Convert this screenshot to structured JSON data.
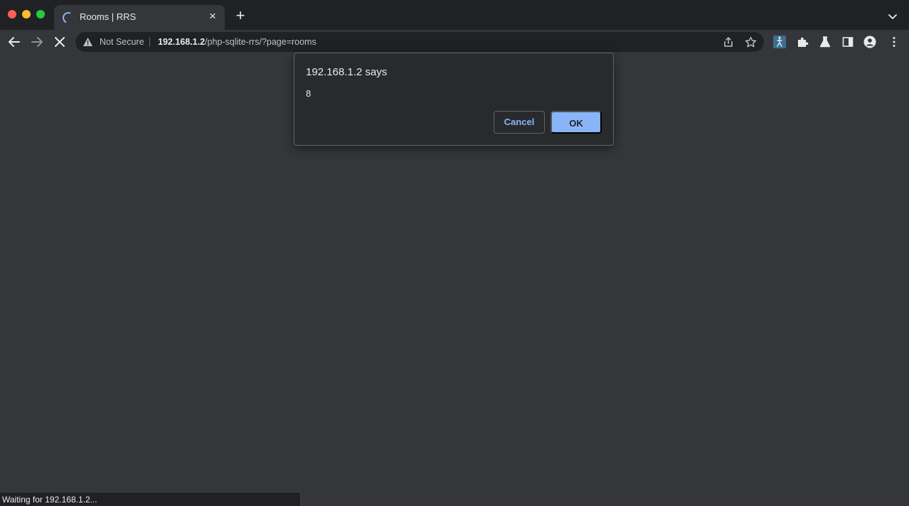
{
  "window": {
    "controls": [
      "close",
      "minimize",
      "maximize"
    ]
  },
  "tab": {
    "title": "Rooms | RRS",
    "loading": true
  },
  "toolbar": {
    "back_icon": "arrow-left-icon",
    "forward_icon": "arrow-right-icon",
    "stop_icon": "close-icon",
    "security_label": "Not Secure",
    "url_host": "192.168.1.2",
    "url_path": "/php-sqlite-rrs/?page=rooms",
    "extensions": [
      "custom-extension-icon",
      "puzzle-icon",
      "flask-icon",
      "side-panel-icon",
      "profile-icon",
      "kebab-menu-icon"
    ]
  },
  "dialog": {
    "title": "192.168.1.2 says",
    "message": "8",
    "cancel_label": "Cancel",
    "ok_label": "OK"
  },
  "status": {
    "text": "Waiting for 192.168.1.2..."
  },
  "colors": {
    "page_bg": "#35363a",
    "chrome_bg": "#202124",
    "accent": "#8ab4f8",
    "close": "#ff5f57",
    "minimize": "#febc2e",
    "maximize": "#28c840"
  }
}
